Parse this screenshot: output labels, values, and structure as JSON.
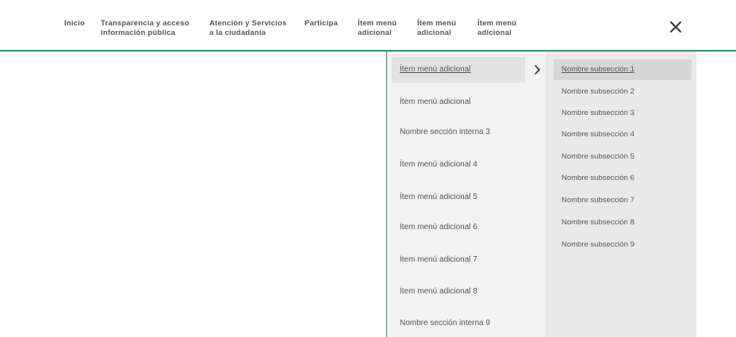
{
  "nav": {
    "items": [
      {
        "lines": [
          "Inicio",
          ""
        ]
      },
      {
        "lines": [
          "Transparencia y acceso",
          "información pública"
        ]
      },
      {
        "lines": [
          "Atención y Servicios",
          "a la ciudadanía"
        ]
      },
      {
        "lines": [
          "Participa",
          ""
        ]
      },
      {
        "lines": [
          "Ítem menú",
          "adicional"
        ]
      },
      {
        "lines": [
          "Ítem menú",
          "adicional"
        ]
      },
      {
        "lines": [
          "Ítem menú",
          "adicional"
        ]
      }
    ],
    "close_icon": "close-icon"
  },
  "menu": {
    "column1": [
      {
        "label": "Ítem menú adicional",
        "active": true
      },
      {
        "label": "Ítem menú adicional",
        "active": false
      },
      {
        "label": "Nombre sección interna 3",
        "active": false
      },
      {
        "label": "Ítem menú adicional 4",
        "active": false
      },
      {
        "label": "Ítem menú adicional 5",
        "active": false
      },
      {
        "label": "Ítem menú adicional 6",
        "active": false
      },
      {
        "label": "Ítem menú adicional 7",
        "active": false
      },
      {
        "label": "Ítem menú adicional 8",
        "active": false
      },
      {
        "label": "Nombre sección interna 9",
        "active": false
      }
    ],
    "column2": [
      {
        "label": "Nombre subsección 1",
        "active": true
      },
      {
        "label": "Nombre subsección 2",
        "active": false
      },
      {
        "label": "Nombre subsección 3",
        "active": false
      },
      {
        "label": "Nombre subsección 4",
        "active": false
      },
      {
        "label": "Nombre subsección 5",
        "active": false
      },
      {
        "label": "Nombre subsección 6",
        "active": false
      },
      {
        "label": "Nombre subsección 7",
        "active": false
      },
      {
        "label": "Nombre subsección 8",
        "active": false
      },
      {
        "label": "Nombre subsección 9",
        "active": false
      }
    ],
    "expand_icon": "chevron-right-icon"
  },
  "colors": {
    "accent": "#2f8c6b",
    "column1_bg": "#f2f2f2",
    "column2_bg": "#e9e9e9"
  }
}
